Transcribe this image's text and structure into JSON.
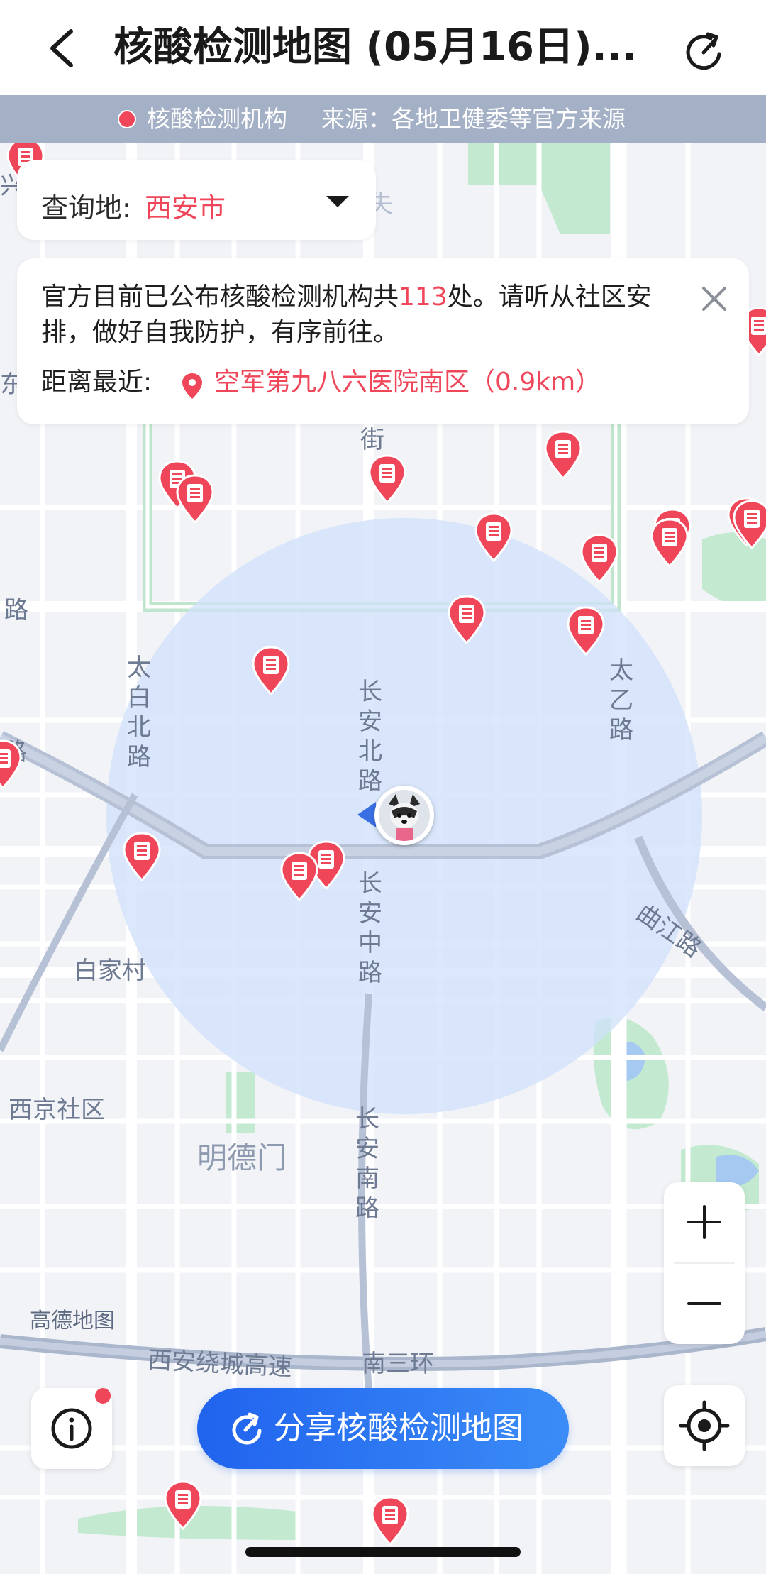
{
  "header": {
    "title": "核酸检测地图 (05月16日)...",
    "back_icon": "chevron-left-icon",
    "refresh_icon": "share-refresh-icon"
  },
  "source_bar": {
    "legend_label": "核酸检测机构",
    "source_text": "来源：各地卫健委等官方来源",
    "legend_color": "#f0465a"
  },
  "query": {
    "label": "查询地:",
    "city": "西安市"
  },
  "notice": {
    "text_before": "官方目前已公布核酸检测机构共",
    "count": "113",
    "text_after": "处。请听从社区安排，做好自我防护，有序前往。",
    "nearest_label": "距离最近:",
    "nearest_value": "空军第九八六医院南区（0.9km）"
  },
  "map_labels": {
    "chang_an_bei": "长安北路",
    "chang_an_zhong": "长安中路",
    "chang_an_nan": "长安南路",
    "tai_bai_bei": "太白北路",
    "tai_yi": "太乙路",
    "qu_jiang": "曲江路",
    "bai_jia_cun": "白家村",
    "xi_jing": "西京社区",
    "ming_de_men": "明德门",
    "gaode": "高德地图",
    "rao_cheng": "西安绕城高速",
    "nan_san_huan": "南三环",
    "jie": "街",
    "lu_left": "路",
    "lu_left2": "路",
    "xing": "兴",
    "shi": "失",
    "east_mark": "东"
  },
  "share": {
    "label": "分享核酸检测地图"
  },
  "colors": {
    "accent": "#2f7bf2",
    "pin": "#f0465a",
    "radius_fill": "#cfe0fb"
  }
}
